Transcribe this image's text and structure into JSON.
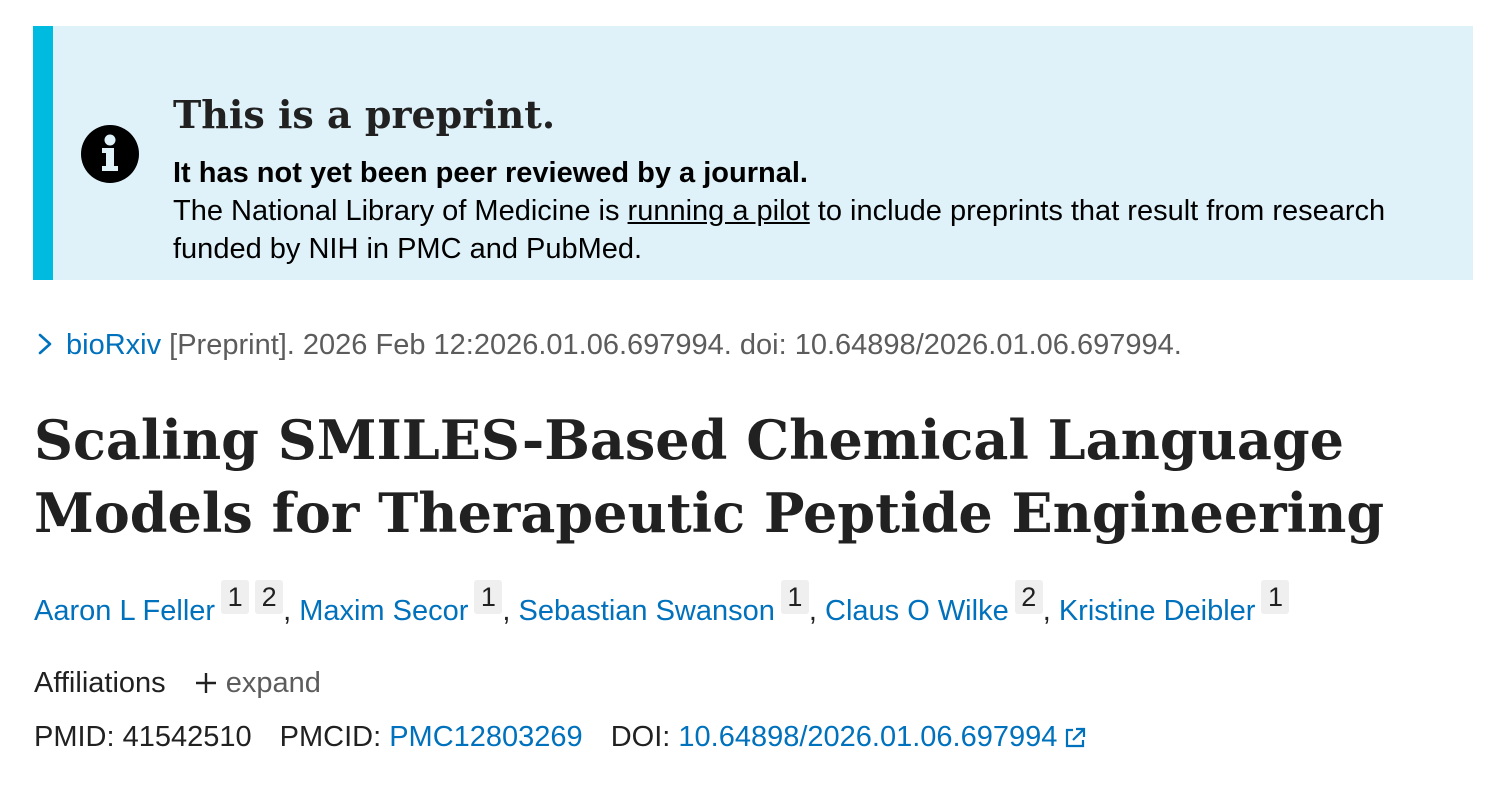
{
  "banner": {
    "title": "This is a preprint.",
    "subtitle": "It has not yet been peer reviewed by a journal.",
    "body_prefix": "The National Library of Medicine is ",
    "body_link": "running a pilot",
    "body_suffix": " to include preprints that result from research funded by NIH in PMC and PubMed.",
    "icon": "info-icon",
    "accent_color": "#00bbe0",
    "background_color": "#e0f2f9"
  },
  "citation": {
    "journal": "bioRxiv",
    "details": " [Preprint]. 2026 Feb 12:2026.01.06.697994. doi: 10.64898/2026.01.06.697994.",
    "icon": "chevron-right-icon"
  },
  "article": {
    "title": "Scaling SMILES-Based Chemical Language Models for Therapeutic Peptide Engineering"
  },
  "authors": [
    {
      "name": "Aaron L Feller",
      "affiliations": [
        "1",
        "2"
      ]
    },
    {
      "name": "Maxim Secor",
      "affiliations": [
        "1"
      ]
    },
    {
      "name": "Sebastian Swanson",
      "affiliations": [
        "1"
      ]
    },
    {
      "name": "Claus O Wilke",
      "affiliations": [
        "2"
      ]
    },
    {
      "name": "Kristine Deibler",
      "affiliations": [
        "1"
      ]
    }
  ],
  "author_separator": ", ",
  "affiliations": {
    "label": "Affiliations",
    "expand_label": "expand"
  },
  "identifiers": {
    "pmid_label": "PMID: ",
    "pmid": "41542510",
    "pmcid_label": "PMCID: ",
    "pmcid": "PMC12803269",
    "doi_label": "DOI: ",
    "doi": "10.64898/2026.01.06.697994"
  },
  "colors": {
    "link": "#0071bc",
    "text": "#212121",
    "muted": "#5c5c5c"
  }
}
